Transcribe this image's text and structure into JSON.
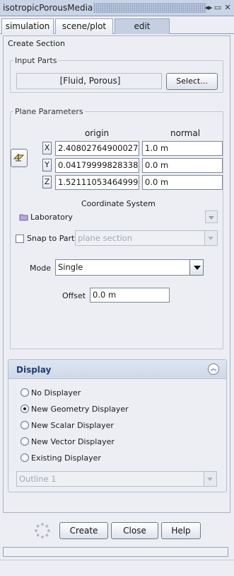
{
  "window": {
    "title": "isotropicPorousMedia",
    "controls": [
      "dock-icon",
      "restore-icon",
      "close-icon"
    ]
  },
  "tabs": [
    {
      "label": "simulation",
      "active": false
    },
    {
      "label": "scene/plot",
      "active": false
    },
    {
      "label": "edit",
      "active": true
    }
  ],
  "create_section": {
    "title": "Create Section",
    "input_parts": {
      "title": "Input Parts",
      "value": "[Fluid, Porous]",
      "select_label": "Select..."
    },
    "plane_parameters": {
      "title": "Plane Parameters",
      "origin_header": "origin",
      "normal_header": "normal",
      "rows": [
        {
          "axis": "X",
          "origin": "2.40802764900027",
          "normal": "1.0 m"
        },
        {
          "axis": "Y",
          "origin": "0.04179999828338",
          "normal": "0.0 m"
        },
        {
          "axis": "Z",
          "origin": "1.52111053464999",
          "normal": "0.0 m"
        }
      ],
      "coordinate_system_label": "Coordinate System",
      "coordinate_system_value": "Laboratory",
      "snap_to_part_label": "Snap to Part",
      "snap_to_part_checked": false,
      "snap_to_part_value": "plane section",
      "mode_label": "Mode",
      "mode_value": "Single",
      "offset_label": "Offset",
      "offset_value": "0.0 m"
    }
  },
  "display": {
    "title": "Display",
    "options": [
      {
        "label": "No Displayer",
        "selected": false
      },
      {
        "label": "New Geometry Displayer",
        "selected": true
      },
      {
        "label": "New Scalar Displayer",
        "selected": false
      },
      {
        "label": "New Vector Displayer",
        "selected": false
      },
      {
        "label": "Existing Displayer",
        "selected": false
      }
    ],
    "existing_value": "Outline 1"
  },
  "footer": {
    "create_label": "Create",
    "close_label": "Close",
    "help_label": "Help"
  },
  "colors": {
    "background": "#eceef3",
    "title_bar": "#c9d4e6",
    "active_tab": "#c4d0e2",
    "display_header": "#d5deeb",
    "display_title": "#1f3d73"
  }
}
